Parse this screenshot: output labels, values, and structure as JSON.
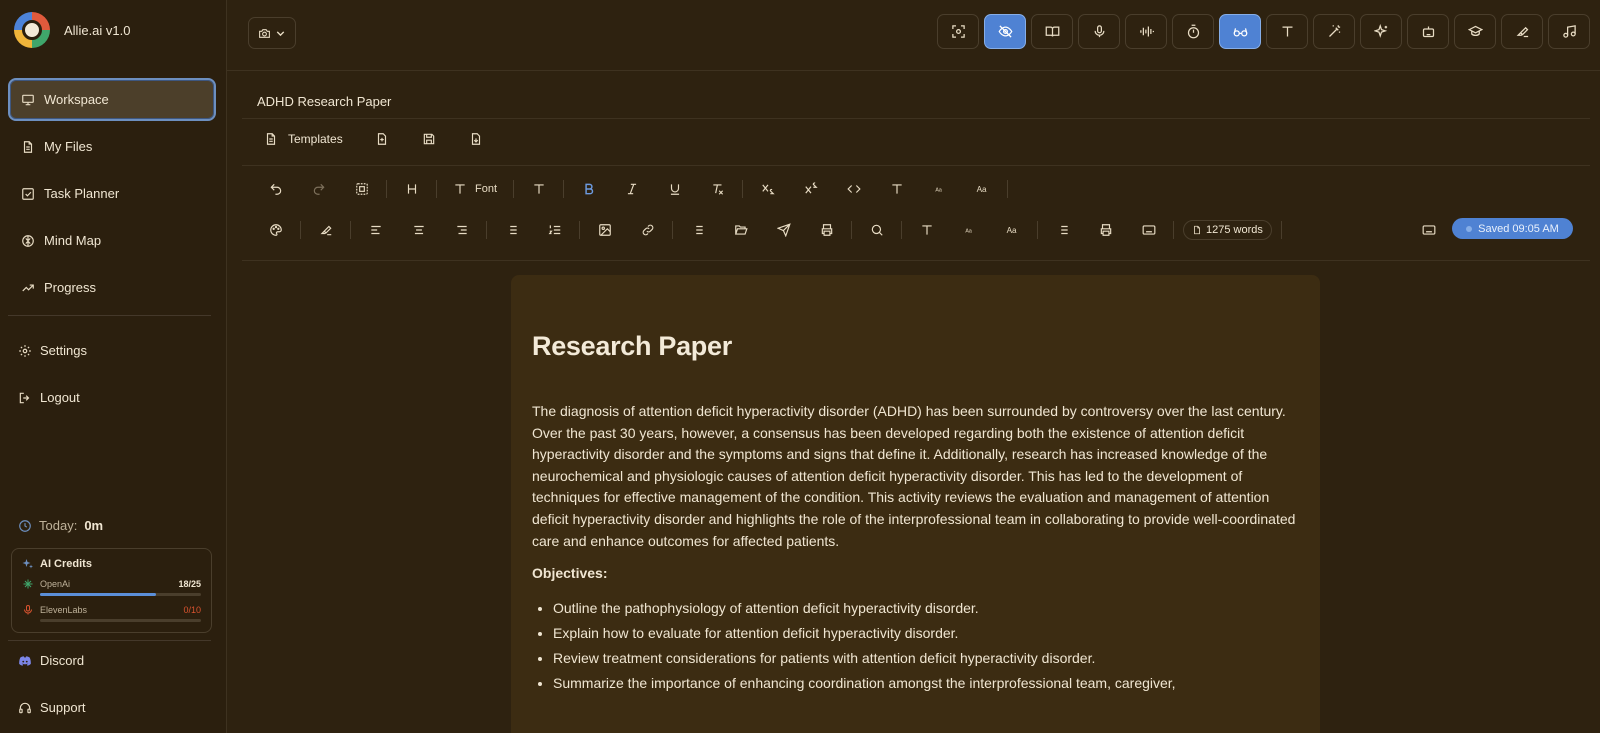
{
  "app": {
    "name": "Allie.ai v1.0"
  },
  "sidebar": {
    "items": [
      {
        "label": "Workspace",
        "icon": "monitor-icon",
        "active": true
      },
      {
        "label": "My Files",
        "icon": "file-icon"
      },
      {
        "label": "Task Planner",
        "icon": "checkbox-icon"
      },
      {
        "label": "Mind Map",
        "icon": "brain-icon"
      },
      {
        "label": "Progress",
        "icon": "trending-up-icon"
      }
    ],
    "settings_label": "Settings",
    "logout_label": "Logout",
    "today_label": "Today:",
    "today_value": "0m",
    "credits": {
      "title": "AI Credits",
      "openai": {
        "label": "OpenAi",
        "count": "18/25",
        "fraction": 0.72
      },
      "elevenlabs": {
        "label": "ElevenLabs",
        "count": "0/10",
        "fraction": 0.0
      }
    },
    "discord_label": "Discord",
    "support_label": "Support"
  },
  "toolbar_top": {
    "tools": [
      "focus-icon",
      "eye-off-icon",
      "book-icon",
      "mic-icon",
      "audio-wave-icon",
      "timer-icon",
      "glasses-icon",
      "text-icon",
      "magic-wand-icon",
      "sparkles-icon",
      "robot-icon",
      "graduation-cap-icon",
      "highlighter-icon",
      "music-icon"
    ],
    "active_tools": [
      "eye-off-icon",
      "glasses-icon"
    ]
  },
  "document": {
    "title": "ADHD Research Paper",
    "templates_label": "Templates",
    "font_label": "Font",
    "word_count": "1275 words",
    "saved_status": "Saved 09:05 AM",
    "heading": "Research Paper",
    "body": "The diagnosis of attention deficit hyperactivity disorder (ADHD) has been surrounded by controversy over the last century. Over the past 30 years, however, a consensus has been developed regarding both the existence of attention deficit hyperactivity disorder and the symptoms and signs that define it. Additionally, research has increased knowledge of the neurochemical and physiologic causes of attention deficit hyperactivity disorder. This has led to the development of techniques for effective management of the condition. This activity reviews the evaluation and management of attention deficit hyperactivity disorder and highlights the role of the interprofessional team in collaborating to provide well-coordinated care and enhance outcomes for affected patients.",
    "objectives_heading": "Objectives:",
    "objectives": [
      "Outline the pathophysiology of attention deficit hyperactivity disorder.",
      "Explain how to evaluate for attention deficit hyperactivity disorder.",
      "Review treatment considerations for patients with attention deficit hyperactivity disorder.",
      "Summarize the importance of enhancing coordination amongst the interprofessional team, caregiver,"
    ]
  },
  "colors": {
    "background": "#2e2210",
    "accent": "#4f82d3",
    "paper": "#3c2c12",
    "error": "#d9532f"
  }
}
